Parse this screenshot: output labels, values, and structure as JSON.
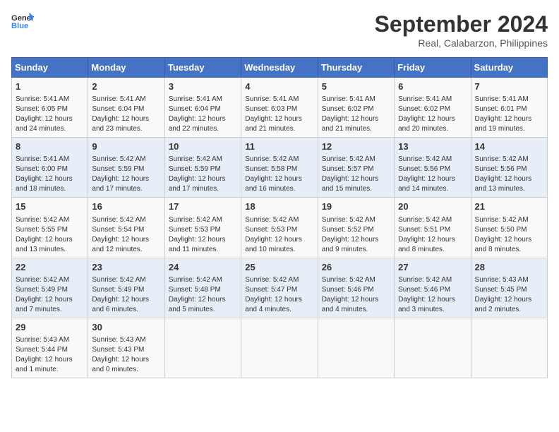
{
  "header": {
    "logo_general": "General",
    "logo_blue": "Blue",
    "month": "September 2024",
    "location": "Real, Calabarzon, Philippines"
  },
  "days_of_week": [
    "Sunday",
    "Monday",
    "Tuesday",
    "Wednesday",
    "Thursday",
    "Friday",
    "Saturday"
  ],
  "weeks": [
    [
      {
        "day": "1",
        "info": "Sunrise: 5:41 AM\nSunset: 6:05 PM\nDaylight: 12 hours\nand 24 minutes."
      },
      {
        "day": "2",
        "info": "Sunrise: 5:41 AM\nSunset: 6:04 PM\nDaylight: 12 hours\nand 23 minutes."
      },
      {
        "day": "3",
        "info": "Sunrise: 5:41 AM\nSunset: 6:04 PM\nDaylight: 12 hours\nand 22 minutes."
      },
      {
        "day": "4",
        "info": "Sunrise: 5:41 AM\nSunset: 6:03 PM\nDaylight: 12 hours\nand 21 minutes."
      },
      {
        "day": "5",
        "info": "Sunrise: 5:41 AM\nSunset: 6:02 PM\nDaylight: 12 hours\nand 21 minutes."
      },
      {
        "day": "6",
        "info": "Sunrise: 5:41 AM\nSunset: 6:02 PM\nDaylight: 12 hours\nand 20 minutes."
      },
      {
        "day": "7",
        "info": "Sunrise: 5:41 AM\nSunset: 6:01 PM\nDaylight: 12 hours\nand 19 minutes."
      }
    ],
    [
      {
        "day": "8",
        "info": "Sunrise: 5:41 AM\nSunset: 6:00 PM\nDaylight: 12 hours\nand 18 minutes."
      },
      {
        "day": "9",
        "info": "Sunrise: 5:42 AM\nSunset: 5:59 PM\nDaylight: 12 hours\nand 17 minutes."
      },
      {
        "day": "10",
        "info": "Sunrise: 5:42 AM\nSunset: 5:59 PM\nDaylight: 12 hours\nand 17 minutes."
      },
      {
        "day": "11",
        "info": "Sunrise: 5:42 AM\nSunset: 5:58 PM\nDaylight: 12 hours\nand 16 minutes."
      },
      {
        "day": "12",
        "info": "Sunrise: 5:42 AM\nSunset: 5:57 PM\nDaylight: 12 hours\nand 15 minutes."
      },
      {
        "day": "13",
        "info": "Sunrise: 5:42 AM\nSunset: 5:56 PM\nDaylight: 12 hours\nand 14 minutes."
      },
      {
        "day": "14",
        "info": "Sunrise: 5:42 AM\nSunset: 5:56 PM\nDaylight: 12 hours\nand 13 minutes."
      }
    ],
    [
      {
        "day": "15",
        "info": "Sunrise: 5:42 AM\nSunset: 5:55 PM\nDaylight: 12 hours\nand 13 minutes."
      },
      {
        "day": "16",
        "info": "Sunrise: 5:42 AM\nSunset: 5:54 PM\nDaylight: 12 hours\nand 12 minutes."
      },
      {
        "day": "17",
        "info": "Sunrise: 5:42 AM\nSunset: 5:53 PM\nDaylight: 12 hours\nand 11 minutes."
      },
      {
        "day": "18",
        "info": "Sunrise: 5:42 AM\nSunset: 5:53 PM\nDaylight: 12 hours\nand 10 minutes."
      },
      {
        "day": "19",
        "info": "Sunrise: 5:42 AM\nSunset: 5:52 PM\nDaylight: 12 hours\nand 9 minutes."
      },
      {
        "day": "20",
        "info": "Sunrise: 5:42 AM\nSunset: 5:51 PM\nDaylight: 12 hours\nand 8 minutes."
      },
      {
        "day": "21",
        "info": "Sunrise: 5:42 AM\nSunset: 5:50 PM\nDaylight: 12 hours\nand 8 minutes."
      }
    ],
    [
      {
        "day": "22",
        "info": "Sunrise: 5:42 AM\nSunset: 5:49 PM\nDaylight: 12 hours\nand 7 minutes."
      },
      {
        "day": "23",
        "info": "Sunrise: 5:42 AM\nSunset: 5:49 PM\nDaylight: 12 hours\nand 6 minutes."
      },
      {
        "day": "24",
        "info": "Sunrise: 5:42 AM\nSunset: 5:48 PM\nDaylight: 12 hours\nand 5 minutes."
      },
      {
        "day": "25",
        "info": "Sunrise: 5:42 AM\nSunset: 5:47 PM\nDaylight: 12 hours\nand 4 minutes."
      },
      {
        "day": "26",
        "info": "Sunrise: 5:42 AM\nSunset: 5:46 PM\nDaylight: 12 hours\nand 4 minutes."
      },
      {
        "day": "27",
        "info": "Sunrise: 5:42 AM\nSunset: 5:46 PM\nDaylight: 12 hours\nand 3 minutes."
      },
      {
        "day": "28",
        "info": "Sunrise: 5:43 AM\nSunset: 5:45 PM\nDaylight: 12 hours\nand 2 minutes."
      }
    ],
    [
      {
        "day": "29",
        "info": "Sunrise: 5:43 AM\nSunset: 5:44 PM\nDaylight: 12 hours\nand 1 minute."
      },
      {
        "day": "30",
        "info": "Sunrise: 5:43 AM\nSunset: 5:43 PM\nDaylight: 12 hours\nand 0 minutes."
      },
      {
        "day": "",
        "info": ""
      },
      {
        "day": "",
        "info": ""
      },
      {
        "day": "",
        "info": ""
      },
      {
        "day": "",
        "info": ""
      },
      {
        "day": "",
        "info": ""
      }
    ]
  ]
}
